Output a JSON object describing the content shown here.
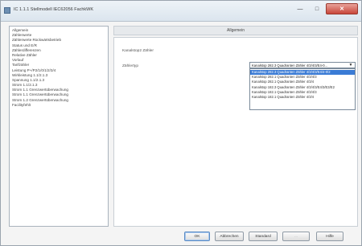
{
  "window": {
    "title": "IC 1.1.1 Stellmodell IEC62056 FachkWK",
    "minimize": "—",
    "maximize": "□",
    "close": "✕"
  },
  "sidebar": {
    "items": [
      {
        "label": "Allgemein"
      },
      {
        "label": "Zählerwerte"
      },
      {
        "label": "Zählerwerte Rückwärtsbetrieb"
      },
      {
        "label": "Status und E/R"
      },
      {
        "label": "Zählerdifferenzen"
      },
      {
        "label": "Relative Zähler"
      },
      {
        "label": "Vorlauf"
      },
      {
        "label": "Tarifzähler"
      },
      {
        "label": "Leistung P+/P2/1/0/1/2/3/4"
      },
      {
        "label": "Wirkleistung 1.1/2.1.3"
      },
      {
        "label": "Spannung 1.1/2.1.3"
      },
      {
        "label": "Strom 1.1/2.1.3"
      },
      {
        "label": "Strom 1.1 Grenzwertüberwachung"
      },
      {
        "label": "Strom 1.1 Grenzwertüberwachung"
      },
      {
        "label": "Strom 1.2 Grenzwertüberwachung"
      },
      {
        "label": "Facilityfehlt"
      }
    ]
  },
  "main": {
    "section_title": "Allgemein",
    "label_1": "Kanalstop2 Zähler",
    "label_2": "Zählertyp",
    "combo": {
      "value": "Kanalstop 282.3 Quadranten Zähler 4/3/4/3/E4-0...",
      "arrow": "▼"
    },
    "dropdown_items": [
      {
        "label": "Kanalstop 282.3 Quadranten Zähler 4/3/4/3/E4/4-0/2",
        "selected": true
      },
      {
        "label": "Kanalstop 282.1 Quadranten Zähler 4/3/4/3",
        "selected": false
      },
      {
        "label": "Kanalstop 282.1 Quadranten Zähler 4/3/4",
        "selected": false
      },
      {
        "label": "Kanalstop 182.3 Quadranten Zähler 4/3/4/3/E4/3/E3/E2",
        "selected": false
      },
      {
        "label": "Kanalstop 182.1 Quadranten Zähler 4/3/4/3",
        "selected": false
      },
      {
        "label": "Kanalstop 182.1 Quadranten Zähler 4/3/4",
        "selected": false
      }
    ]
  },
  "buttons": {
    "ok": "OK",
    "cancel": "Abbrechen",
    "default": "Standard",
    "apply": "...",
    "help": "Hilfe"
  }
}
